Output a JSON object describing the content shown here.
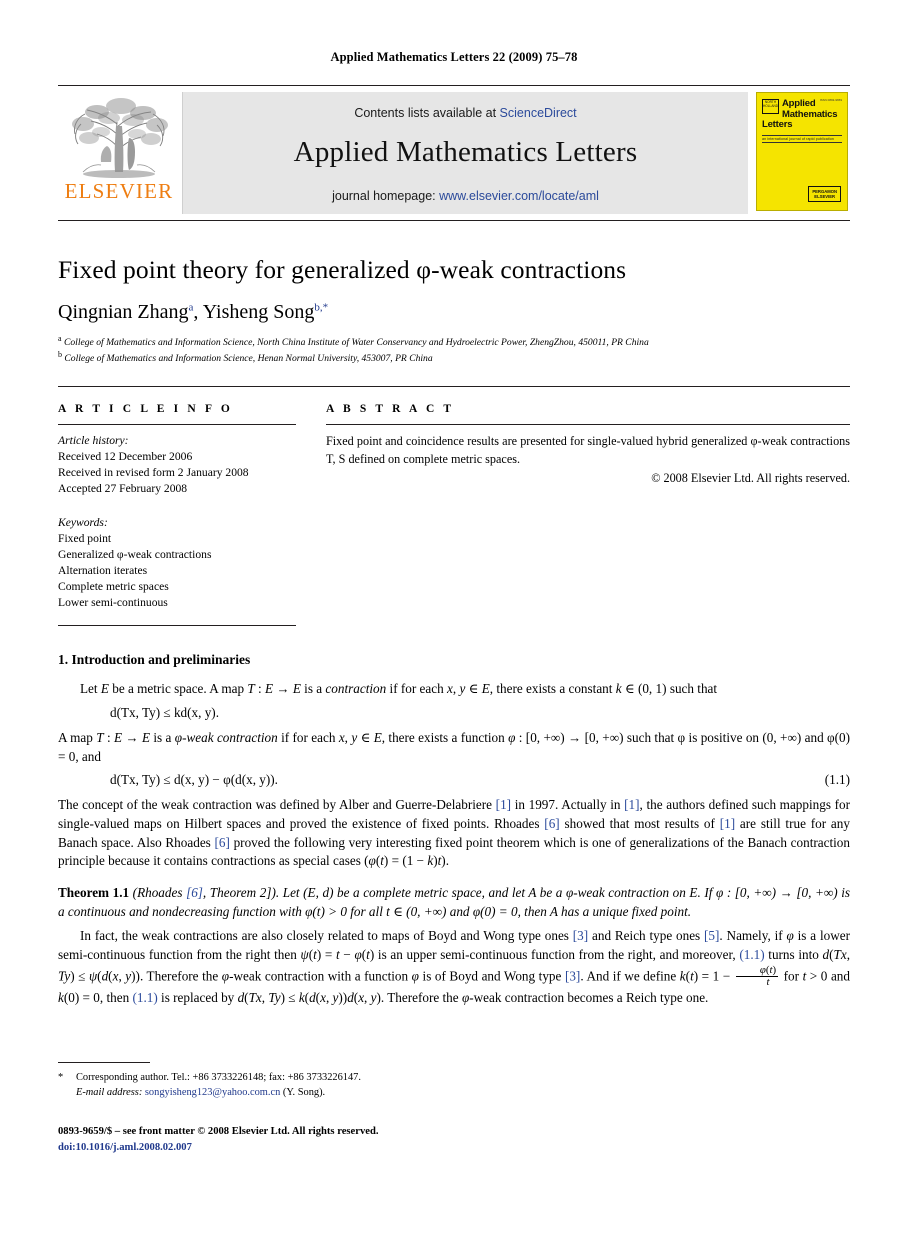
{
  "running_head": "Applied Mathematics Letters 22 (2009) 75–78",
  "banner": {
    "contents_prefix": "Contents lists available at ",
    "contents_link": "ScienceDirect",
    "journal_name": "Applied Mathematics Letters",
    "homepage_prefix": "journal homepage: ",
    "homepage_link": "www.elsevier.com/locate/aml",
    "publisher_wordmark": "ELSEVIER",
    "link_color": "#2b4a9b",
    "elsevier_orange": "#ee7d11",
    "banner_bg": "#e6e6e6"
  },
  "cover": {
    "logo_text": "NORTH HOLLAND",
    "corner_text": "ISSN 0893-9659",
    "title_line1": "Applied",
    "title_line2": "Mathematics",
    "title_line3": "Letters",
    "subtitle": "an international journal of rapid publication",
    "badge_line1": "PERGAMON",
    "badge_line2": "ELSEVIER",
    "bg_color": "#f5e400"
  },
  "article": {
    "title": "Fixed point theory for generalized φ-weak contractions",
    "authors": [
      {
        "name": "Qingnian Zhang",
        "marks": "a"
      },
      {
        "name": "Yisheng Song",
        "marks": "b,*"
      }
    ],
    "affiliations": [
      {
        "mark": "a",
        "text": "College of Mathematics and Information Science, North China Institute of Water Conservancy and Hydroelectric Power, ZhengZhou, 450011, PR China"
      },
      {
        "mark": "b",
        "text": "College of Mathematics and Information Science, Henan Normal University, 453007, PR China"
      }
    ]
  },
  "info": {
    "heading": "A R T I C L E   I N F O",
    "history_label": "Article history:",
    "history": [
      "Received 12 December 2006",
      "Received in revised form 2 January 2008",
      "Accepted 27 February 2008"
    ],
    "keywords_label": "Keywords:",
    "keywords": [
      "Fixed point",
      "Generalized φ-weak contractions",
      "Alternation iterates",
      "Complete metric spaces",
      "Lower semi-continuous"
    ]
  },
  "abstract": {
    "heading": "A B S T R A C T",
    "text": "Fixed point and coincidence results are presented for single-valued hybrid generalized φ-weak contractions T, S defined on complete metric spaces.",
    "copyright": "© 2008 Elsevier Ltd. All rights reserved."
  },
  "body": {
    "section_heading": "1. Introduction and preliminaries",
    "p1_a": "Let ",
    "p1_b": " be a metric space. A map ",
    "p1_c": " is a ",
    "p1_contraction": "contraction",
    "p1_d": " if for each ",
    "p1_e": ", there exists a constant ",
    "p1_f": " such that",
    "eq_contraction": "d(Tx, Ty) ≤ kd(x, y).",
    "p2_a": "A map ",
    "p2_b": " is a ",
    "p2_weak": "φ-weak contraction",
    "p2_c": " if for each ",
    "p2_d": ", there exists a function ",
    "p2_e": " such that φ is positive on (0, +∞) and φ(0) = 0, and",
    "eq_11": "d(Tx, Ty) ≤ d(x, y) − φ(d(x, y)).",
    "eq_11_num": "(1.1)",
    "p3": "The concept of the weak contraction was defined by Alber and Guerre-Delabriere [1] in 1997. Actually in [1], the authors defined such mappings for single-valued maps on Hilbert spaces and proved the existence of fixed points. Rhoades [6] showed that most results of [1] are still true for any Banach space. Also Rhoades [6] proved the following very interesting fixed point theorem which is one of generalizations of the Banach contraction principle because it contains contractions as special cases (φ(t) = (1 − k)t).",
    "theorem_label": "Theorem 1.1",
    "theorem_source": "(Rhoades [6, Theorem 2])",
    "theorem_text": ". Let (E, d) be a complete metric space, and let A be a φ-weak contraction on E. If φ : [0, +∞) → [0, +∞) is a continuous and nondecreasing function with φ(t) > 0 for all t ∈ (0, +∞) and φ(0) = 0, then A has a unique fixed point.",
    "p4": "In fact, the weak contractions are also closely related to maps of Boyd and Wong type ones [3] and Reich type ones [5]. Namely, if φ is a lower semi-continuous function from the right then ψ(t) = t − φ(t) is an upper semi-continuous function from the right, and moreover, (1.1) turns into d(Tx, Ty) ≤ ψ(d(x, y)). Therefore the φ-weak contraction with a function φ is of Boyd and Wong type [3]. And if we define k(t) = 1 − φ(t)/t for t > 0 and k(0) = 0, then (1.1) is replaced by d(Tx, Ty) ≤ k(d(x, y))d(x, y). Therefore the φ-weak contraction becomes a Reich type one.",
    "refs": {
      "r1": "[1]",
      "r3": "[3]",
      "r5": "[5]",
      "r6": "[6]",
      "eq11": "(1.1)"
    }
  },
  "footnote": {
    "marker": "*",
    "corresponding": "Corresponding author. Tel.: +86 3733226148; fax: +86 3733226147.",
    "email_label": "E-mail address:",
    "email": "songyisheng123@yahoo.com.cn",
    "email_suffix": "(Y. Song)."
  },
  "colophon": {
    "issn_line": "0893-9659/$ – see front matter © 2008 Elsevier Ltd. All rights reserved.",
    "doi": "doi:10.1016/j.aml.2008.02.007"
  }
}
